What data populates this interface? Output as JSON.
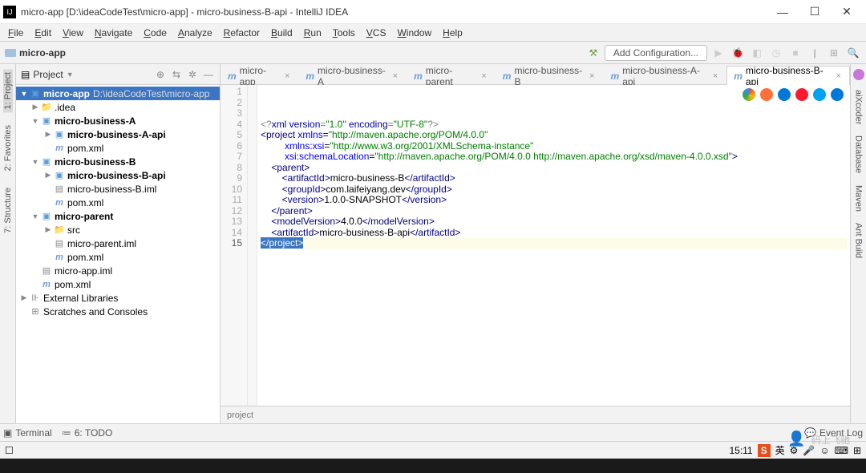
{
  "window": {
    "title": "micro-app [D:\\ideaCodeTest\\micro-app] - micro-business-B-api - IntelliJ IDEA"
  },
  "menus": [
    "File",
    "Edit",
    "View",
    "Navigate",
    "Code",
    "Analyze",
    "Refactor",
    "Build",
    "Run",
    "Tools",
    "VCS",
    "Window",
    "Help"
  ],
  "nav": {
    "path": "micro-app",
    "add_config": "Add Configuration..."
  },
  "left_tabs": [
    "1: Project",
    "2: Favorites",
    "7: Structure"
  ],
  "right_tabs": [
    "aiXcoder",
    "Database",
    "Maven",
    "Ant Build"
  ],
  "project_header": {
    "label": "Project"
  },
  "tree": [
    {
      "d": 0,
      "a": "v",
      "i": "mod",
      "t": "micro-app",
      "x": " D:\\ideaCodeTest\\micro-app",
      "sel": true,
      "b": true
    },
    {
      "d": 1,
      "a": ">",
      "i": "fld",
      "t": ".idea"
    },
    {
      "d": 1,
      "a": "v",
      "i": "mod",
      "t": "micro-business-A",
      "b": true
    },
    {
      "d": 2,
      "a": ">",
      "i": "mod",
      "t": "micro-business-A-api",
      "b": true
    },
    {
      "d": 2,
      "a": "",
      "i": "m",
      "t": "pom.xml"
    },
    {
      "d": 1,
      "a": "v",
      "i": "mod",
      "t": "micro-business-B",
      "b": true
    },
    {
      "d": 2,
      "a": ">",
      "i": "mod",
      "t": "micro-business-B-api",
      "b": true
    },
    {
      "d": 2,
      "a": "",
      "i": "file",
      "t": "micro-business-B.iml"
    },
    {
      "d": 2,
      "a": "",
      "i": "m",
      "t": "pom.xml"
    },
    {
      "d": 1,
      "a": "v",
      "i": "mod",
      "t": "micro-parent",
      "b": true
    },
    {
      "d": 2,
      "a": ">",
      "i": "fld",
      "t": "src"
    },
    {
      "d": 2,
      "a": "",
      "i": "file",
      "t": "micro-parent.iml"
    },
    {
      "d": 2,
      "a": "",
      "i": "m",
      "t": "pom.xml"
    },
    {
      "d": 1,
      "a": "",
      "i": "file",
      "t": "micro-app.iml"
    },
    {
      "d": 1,
      "a": "",
      "i": "m",
      "t": "pom.xml"
    },
    {
      "d": 0,
      "a": ">",
      "i": "lib",
      "t": "External Libraries"
    },
    {
      "d": 0,
      "a": "",
      "i": "scr",
      "t": "Scratches and Consoles"
    }
  ],
  "tabs": [
    {
      "l": "micro-app"
    },
    {
      "l": "micro-business-A"
    },
    {
      "l": "micro-parent"
    },
    {
      "l": "micro-business-B"
    },
    {
      "l": "micro-business-A-api"
    },
    {
      "l": "micro-business-B-api",
      "active": true
    }
  ],
  "lines": 15,
  "code": {
    "l1": "<?xml version=\"1.0\" encoding=\"UTF-8\"?>",
    "ns": "http://maven.apache.org/POM/4.0.0",
    "xsi": "http://www.w3.org/2001/XMLSchema-instance",
    "loc": "http://maven.apache.org/POM/4.0.0 http://maven.apache.org/xsd/maven-4.0.0.xsd",
    "artifact_parent": "micro-business-B",
    "group": "com.laifeiyang.dev",
    "version": "1.0.0-SNAPSHOT",
    "model": "4.0.0",
    "artifact": "micro-business-B-api"
  },
  "breadcrumb": "project",
  "bottom": {
    "terminal": "Terminal",
    "todo": "6: TODO",
    "event": "Event Log"
  },
  "status": {
    "time": "15:11"
  },
  "watermark": "码上飞驰"
}
